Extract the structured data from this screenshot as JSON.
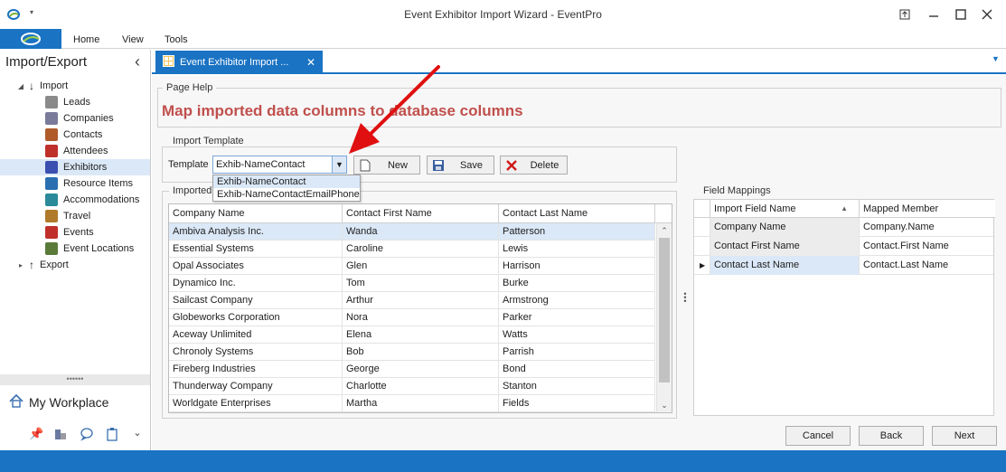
{
  "window": {
    "title": "Event Exhibitor Import Wizard - EventPro",
    "controls": [
      "restore-icon",
      "minimize-icon",
      "maximize-icon",
      "close-icon"
    ]
  },
  "menu": {
    "items": [
      "Home",
      "View",
      "Tools"
    ]
  },
  "nav": {
    "title": "Import/Export",
    "collapse_glyph": "‹",
    "import_label": "Import",
    "items": [
      {
        "label": "Leads",
        "icon": "person-icon",
        "color": "#8a8a8a"
      },
      {
        "label": "Companies",
        "icon": "buildings-icon",
        "color": "#7a7a9a"
      },
      {
        "label": "Contacts",
        "icon": "contacts-icon",
        "color": "#b05a2a"
      },
      {
        "label": "Attendees",
        "icon": "attendees-icon",
        "color": "#c0302a"
      },
      {
        "label": "Exhibitors",
        "icon": "exhibitors-icon",
        "color": "#3a4fb0"
      },
      {
        "label": "Resource Items",
        "icon": "resource-icon",
        "color": "#2a6fb0"
      },
      {
        "label": "Accommodations",
        "icon": "accommodations-icon",
        "color": "#2a8a9a"
      },
      {
        "label": "Travel",
        "icon": "travel-icon",
        "color": "#b07a2a"
      },
      {
        "label": "Events",
        "icon": "pin-icon",
        "color": "#c0302a"
      },
      {
        "label": "Event Locations",
        "icon": "locations-icon",
        "color": "#5a7a3a"
      }
    ],
    "export_label": "Export",
    "splitter_grip": "••••••",
    "workplace_label": "My Workplace"
  },
  "tab": {
    "label": "Event Exhibitor Import ...",
    "close": "✕"
  },
  "page_help": {
    "group_label": "Page Help",
    "text": "Map imported data columns to database columns"
  },
  "import_template": {
    "group_label": "Import Template",
    "template_label": "Template",
    "selected": "Exhib-NameContact",
    "options": [
      "Exhib-NameContact",
      "Exhib-NameContactEmailPhone"
    ],
    "new_label": "New",
    "save_label": "Save",
    "delete_label": "Delete"
  },
  "imported": {
    "group_label": "Imported",
    "columns": [
      "Company Name",
      "Contact First Name",
      "Contact Last Name"
    ],
    "rows": [
      [
        "Ambiva Analysis Inc.",
        "Wanda",
        "Patterson"
      ],
      [
        "Essential Systems",
        "Caroline",
        "Lewis"
      ],
      [
        "Opal Associates",
        "Glen",
        "Harrison"
      ],
      [
        "Dynamico Inc.",
        "Tom",
        "Burke"
      ],
      [
        "Sailcast Company",
        "Arthur",
        "Armstrong"
      ],
      [
        "Globeworks Corporation",
        "Nora",
        "Parker"
      ],
      [
        "Aceway Unlimited",
        "Elena",
        "Watts"
      ],
      [
        "Chronoly Systems",
        "Bob",
        "Parrish"
      ],
      [
        "Fireberg Industries",
        "George",
        "Bond"
      ],
      [
        "Thunderway Company",
        "Charlotte",
        "Stanton"
      ],
      [
        "Worldgate Enterprises",
        "Martha",
        "Fields"
      ]
    ]
  },
  "field_mappings": {
    "group_label": "Field Mappings",
    "columns": [
      "Import Field Name",
      "Mapped Member"
    ],
    "rows": [
      [
        "Company Name",
        "Company.Name"
      ],
      [
        "Contact First Name",
        "Contact.First Name"
      ],
      [
        "Contact Last Name",
        "Contact.Last Name"
      ]
    ]
  },
  "footer": {
    "cancel_label": "Cancel",
    "back_label": "Back",
    "next_label": "Next"
  },
  "colors": {
    "accent": "#1a73c3",
    "help_text": "#c0504d",
    "arrow": "#e01010"
  }
}
